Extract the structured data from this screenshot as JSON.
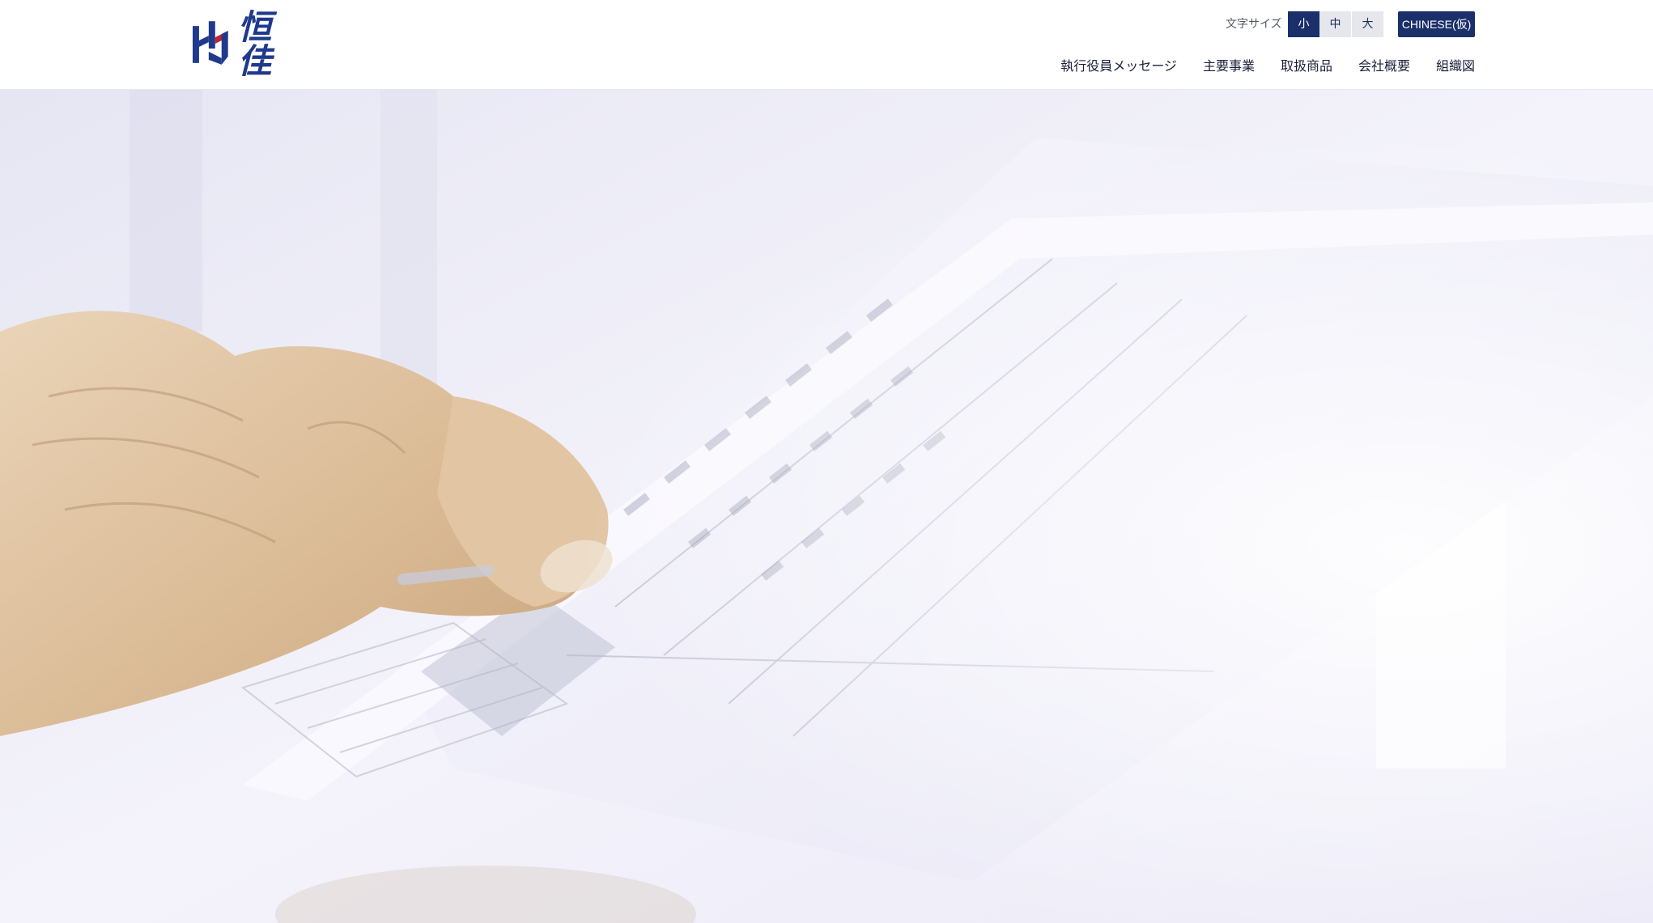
{
  "header": {
    "logo": {
      "text": "恒佳",
      "mark_icon": "hj-logo-mark-icon",
      "brand_color": "#1f3a8c",
      "accent_color": "#c0262d"
    },
    "font_size": {
      "label": "文字サイズ",
      "options": [
        {
          "label": "小",
          "selected": true
        },
        {
          "label": "中",
          "selected": false
        },
        {
          "label": "大",
          "selected": false
        }
      ]
    },
    "language_button": "CHINESE(仮)",
    "nav": [
      {
        "label": "執行役員メッセージ"
      },
      {
        "label": "主要事業"
      },
      {
        "label": "取扱商品"
      },
      {
        "label": "会社概要"
      },
      {
        "label": "組織図"
      }
    ]
  },
  "hero": {
    "image_subject": "hand holding printed data sheet",
    "colors": {
      "primary": "#1b2f6b",
      "tint": "#eeedf8"
    }
  }
}
